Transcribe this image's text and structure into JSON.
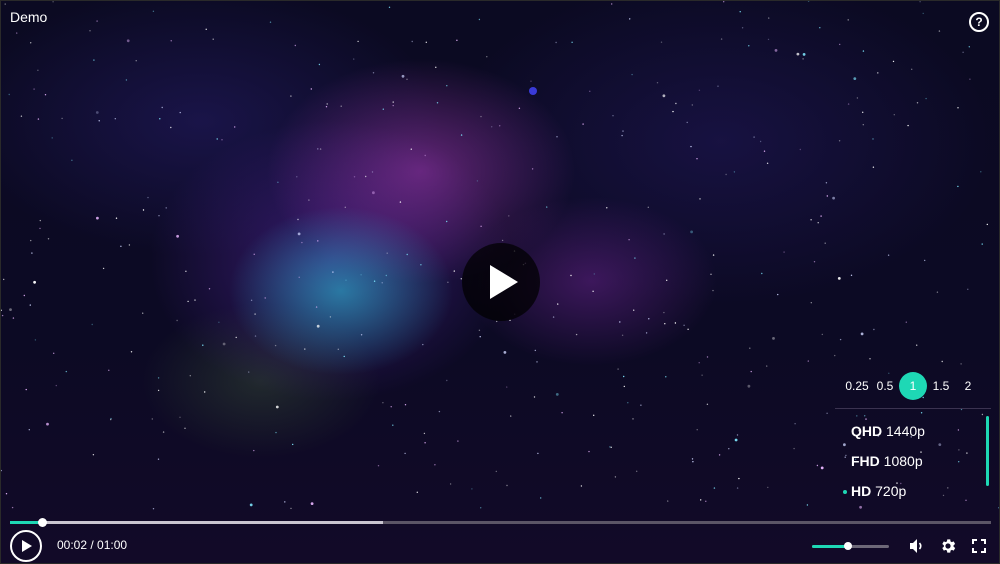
{
  "title": "Demo",
  "icons": {
    "help": "help-circle-icon",
    "big_play": "play-icon",
    "play": "play-icon",
    "volume": "volume-icon",
    "settings": "gear-icon",
    "fullscreen": "fullscreen-icon"
  },
  "colors": {
    "accent": "#1ed8b5",
    "background": "#0b0a22"
  },
  "help_glyph": "?",
  "time": {
    "current": "00:02",
    "separator": " / ",
    "duration": "01:00"
  },
  "progress": {
    "played_fraction": 0.033,
    "buffered_fraction": 0.38
  },
  "volume": {
    "level_fraction": 0.47
  },
  "speed_options": [
    "0.25",
    "0.5",
    "1",
    "1.5",
    "2"
  ],
  "selected_speed": "1",
  "qualities": [
    {
      "name": "QHD",
      "resolution": "1440p",
      "selected": false
    },
    {
      "name": "FHD",
      "resolution": "1080p",
      "selected": false
    },
    {
      "name": "HD",
      "resolution": "720p",
      "selected": true
    }
  ]
}
